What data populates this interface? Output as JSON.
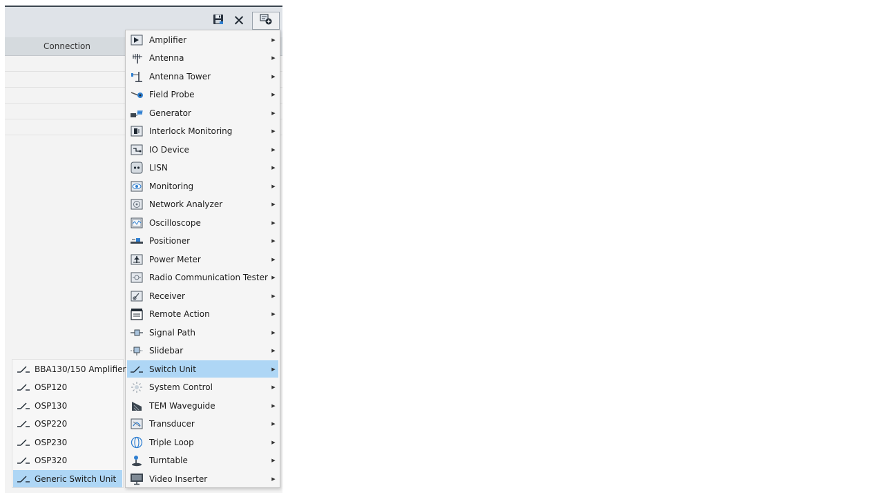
{
  "toolbar": {
    "save_icon": "save-icon",
    "close_icon": "close-icon",
    "add_icon": "add-device-icon"
  },
  "grid": {
    "columns": [
      "Connection"
    ]
  },
  "device_menu": {
    "items": [
      {
        "label": "Amplifier",
        "icon": "amplifier-icon"
      },
      {
        "label": "Antenna",
        "icon": "antenna-icon"
      },
      {
        "label": "Antenna Tower",
        "icon": "antenna-tower-icon"
      },
      {
        "label": "Field Probe",
        "icon": "field-probe-icon"
      },
      {
        "label": "Generator",
        "icon": "generator-icon"
      },
      {
        "label": "Interlock Monitoring",
        "icon": "interlock-icon"
      },
      {
        "label": "IO Device",
        "icon": "io-device-icon"
      },
      {
        "label": "LISN",
        "icon": "lisn-icon"
      },
      {
        "label": "Monitoring",
        "icon": "monitoring-icon"
      },
      {
        "label": "Network Analyzer",
        "icon": "network-analyzer-icon"
      },
      {
        "label": "Oscilloscope",
        "icon": "oscilloscope-icon"
      },
      {
        "label": "Positioner",
        "icon": "positioner-icon"
      },
      {
        "label": "Power Meter",
        "icon": "power-meter-icon"
      },
      {
        "label": "Radio Communication Tester",
        "icon": "radio-tester-icon"
      },
      {
        "label": "Receiver",
        "icon": "receiver-icon"
      },
      {
        "label": "Remote Action",
        "icon": "remote-action-icon"
      },
      {
        "label": "Signal Path",
        "icon": "signal-path-icon"
      },
      {
        "label": "Slidebar",
        "icon": "slidebar-icon"
      },
      {
        "label": "Switch Unit",
        "icon": "switch-unit-icon"
      },
      {
        "label": "System Control",
        "icon": "system-control-icon"
      },
      {
        "label": "TEM Waveguide",
        "icon": "tem-waveguide-icon"
      },
      {
        "label": "Transducer",
        "icon": "transducer-icon"
      },
      {
        "label": "Triple Loop",
        "icon": "triple-loop-icon"
      },
      {
        "label": "Turntable",
        "icon": "turntable-icon"
      },
      {
        "label": "Video Inserter",
        "icon": "video-inserter-icon"
      }
    ],
    "highlighted": "Switch Unit"
  },
  "switch_unit_submenu": {
    "items": [
      {
        "label": "BBA130/150 Amplifier",
        "icon": "switch-unit-icon"
      },
      {
        "label": "OSP120",
        "icon": "switch-unit-icon"
      },
      {
        "label": "OSP130",
        "icon": "switch-unit-icon"
      },
      {
        "label": "OSP220",
        "icon": "switch-unit-icon"
      },
      {
        "label": "OSP230",
        "icon": "switch-unit-icon"
      },
      {
        "label": "OSP320",
        "icon": "switch-unit-icon"
      },
      {
        "label": "Generic Switch Unit",
        "icon": "switch-unit-icon"
      }
    ],
    "highlighted": "Generic Switch Unit"
  },
  "colors": {
    "highlight": "#aed6f5",
    "toolbar": "#dfe3e8",
    "header": "#d5dade",
    "menu_background": "#f5f5f5"
  }
}
